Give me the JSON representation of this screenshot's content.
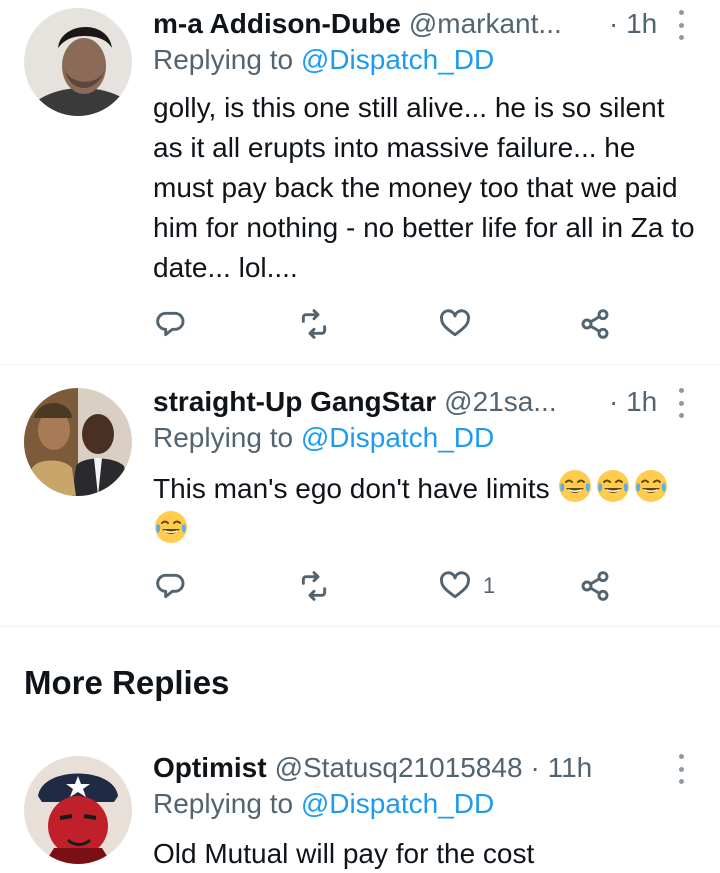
{
  "replies": [
    {
      "name": "m-a Addison-Dube",
      "handle": "@markant...",
      "time": "· 1h",
      "replying_prefix": "Replying to ",
      "replying_to": "@Dispatch_DD",
      "text": "golly, is this one still alive... he is so silent as it all erupts into massive failure... he must pay back the money too that we paid him for nothing - no better life for all in Za to date... lol....",
      "like_count": ""
    },
    {
      "name": "straight-Up GangStar",
      "handle": "@21sa...",
      "time": "· 1h",
      "replying_prefix": "Replying to ",
      "replying_to": "@Dispatch_DD",
      "text": "This man's ego don't have limits",
      "emoji": "face-with-tears-of-joy",
      "emoji_count": 4,
      "like_count": "1"
    },
    {
      "name": "Optimist",
      "handle": "@Statusq21015848",
      "time": "· 11h",
      "replying_prefix": "Replying to ",
      "replying_to": "@Dispatch_DD",
      "text": "Old Mutual will pay for the cost",
      "like_count": ""
    }
  ],
  "more_replies_heading": "More Replies",
  "colors": {
    "text": "#0f1419",
    "secondary": "#536471",
    "link": "#1d9bf0",
    "divider": "#eff3f4"
  },
  "icons": [
    "reply-icon",
    "retweet-icon",
    "like-icon",
    "share-icon",
    "more-options-icon"
  ]
}
